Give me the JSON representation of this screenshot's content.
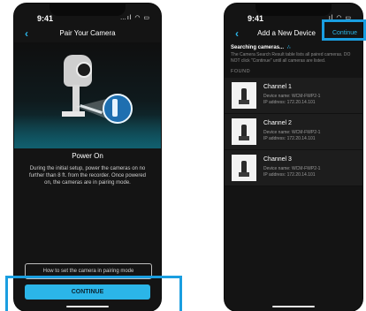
{
  "left": {
    "status_time": "9:41",
    "status_icons": "…ıl ◠ ▭",
    "back": "‹",
    "title": "Pair Your Camera",
    "power_title": "Power On",
    "power_desc": "During the initial setup, power the cameras on no further than 8 ft. from the recorder. Once powered on, the cameras are in pairing mode.",
    "howto": "How to set the camera in pairing mode",
    "continue": "CONTINUE"
  },
  "right": {
    "status_time": "9:41",
    "status_icons": "ıl ◠ ▭",
    "back": "‹",
    "title": "Add a New Device",
    "continue": "Continue",
    "searching": "Searching cameras...",
    "spinner": "∴",
    "hint": "The Camera Search Result table lists all paired cameras. DO NOT click \"Continue\" until all cameras are listed.",
    "found": "FOUND",
    "devices": [
      {
        "title": "Channel 1",
        "name": "Device name: WCM-FWP2-1",
        "ip": "IP address: 172.20.14.101"
      },
      {
        "title": "Channel 2",
        "name": "Device name: WCM-FWP2-1",
        "ip": "IP address: 172.20.14.101"
      },
      {
        "title": "Channel 3",
        "name": "Device name: WCM-FWP2-1",
        "ip": "IP address: 172.20.14.101"
      }
    ]
  },
  "colors": {
    "accent": "#2bb5e8",
    "highlight": "#1a9ee0",
    "background": "#141414"
  }
}
